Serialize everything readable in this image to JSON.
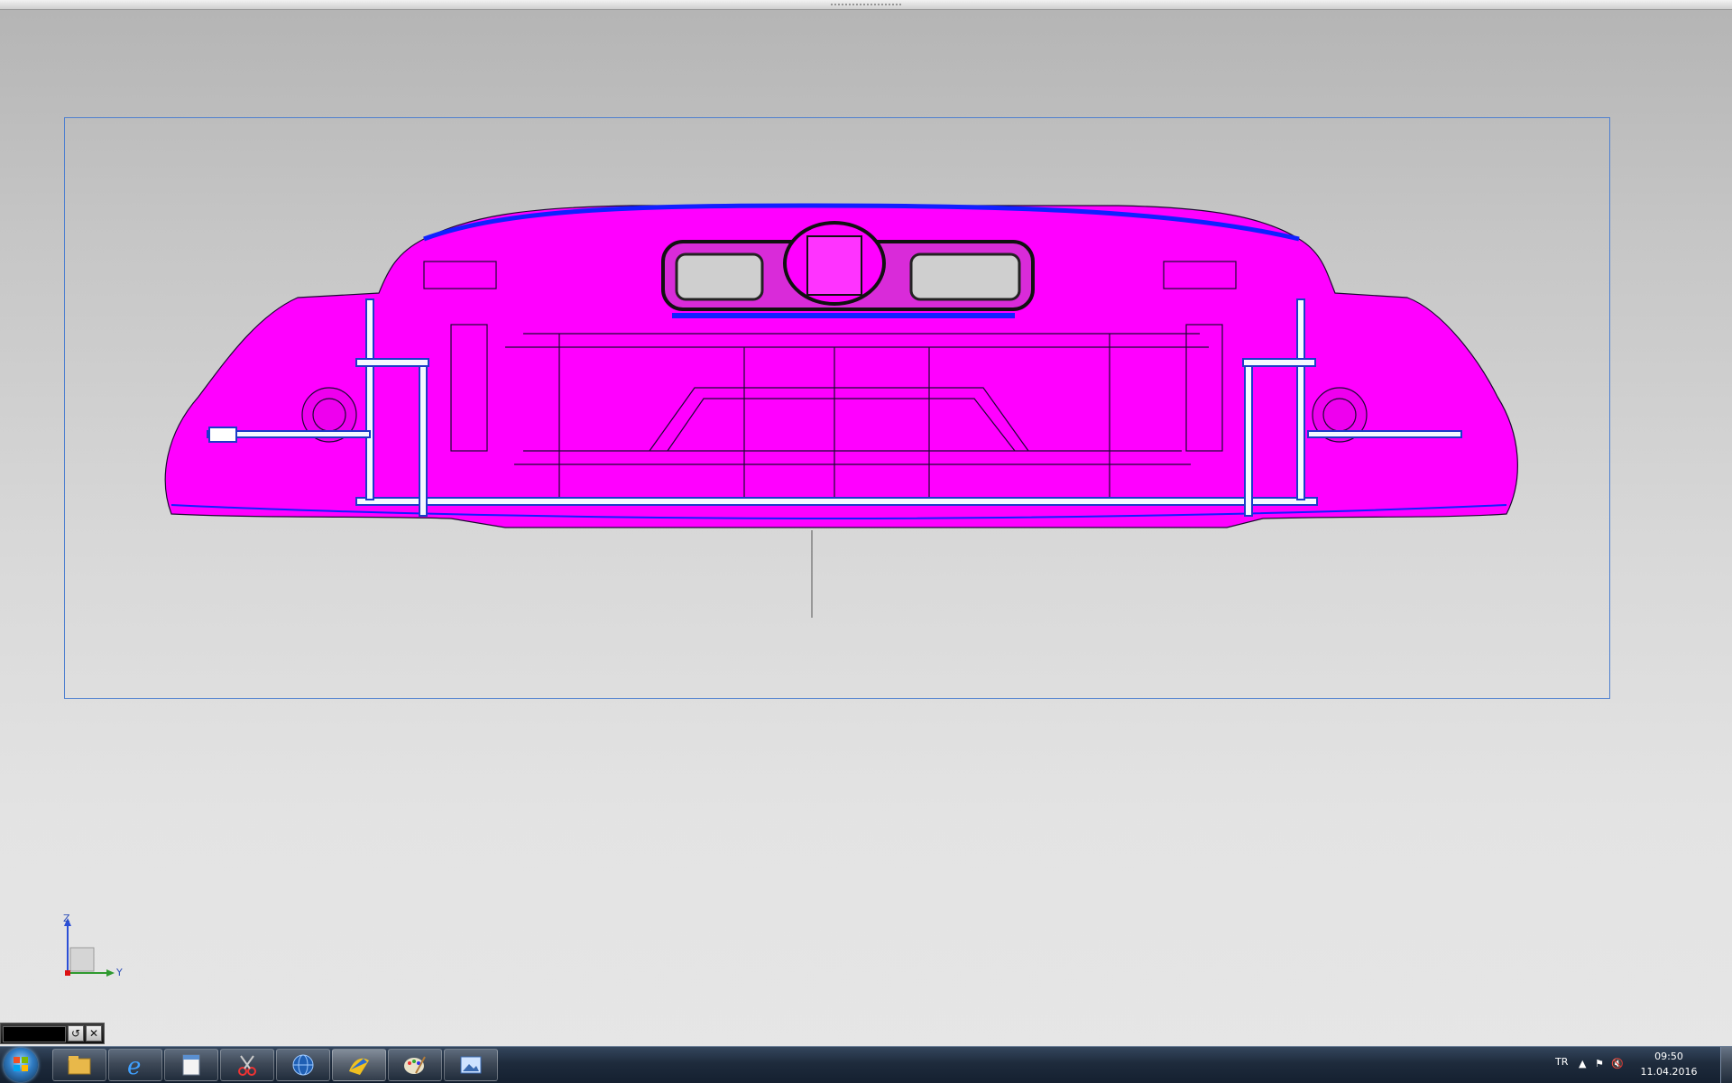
{
  "window": {
    "title": "",
    "background_colors": [
      "#b4b4b4",
      "#e6e6e6"
    ]
  },
  "viewport": {
    "selection_frame_color": "#4f80cf",
    "model_color": "#ff00ff",
    "edge_color": "#1a0a30",
    "highlight_color": "#1020ff"
  },
  "axis_triad": {
    "z_label": "Z",
    "y_label": "Y",
    "icon": "axis-triad-icon"
  },
  "mini_toolbar": {
    "icons": [
      "refresh-icon",
      "close-icon"
    ],
    "refresh_glyph": "↺",
    "close_glyph": "✕"
  },
  "taskbar": {
    "start_icon": "windows-start-icon",
    "apps": [
      {
        "name": "explorer-icon"
      },
      {
        "name": "internet-explorer-icon"
      },
      {
        "name": "notepad-icon"
      },
      {
        "name": "snipping-tool-icon"
      },
      {
        "name": "globe-app-icon"
      },
      {
        "name": "catia-app-icon"
      },
      {
        "name": "paint-icon"
      },
      {
        "name": "image-viewer-icon"
      }
    ],
    "tray": {
      "language": "TR",
      "time": "09:50",
      "date": "11.04.2016",
      "icons": [
        "show-hidden-icons-icon",
        "action-center-icon",
        "volume-muted-icon"
      ]
    }
  }
}
